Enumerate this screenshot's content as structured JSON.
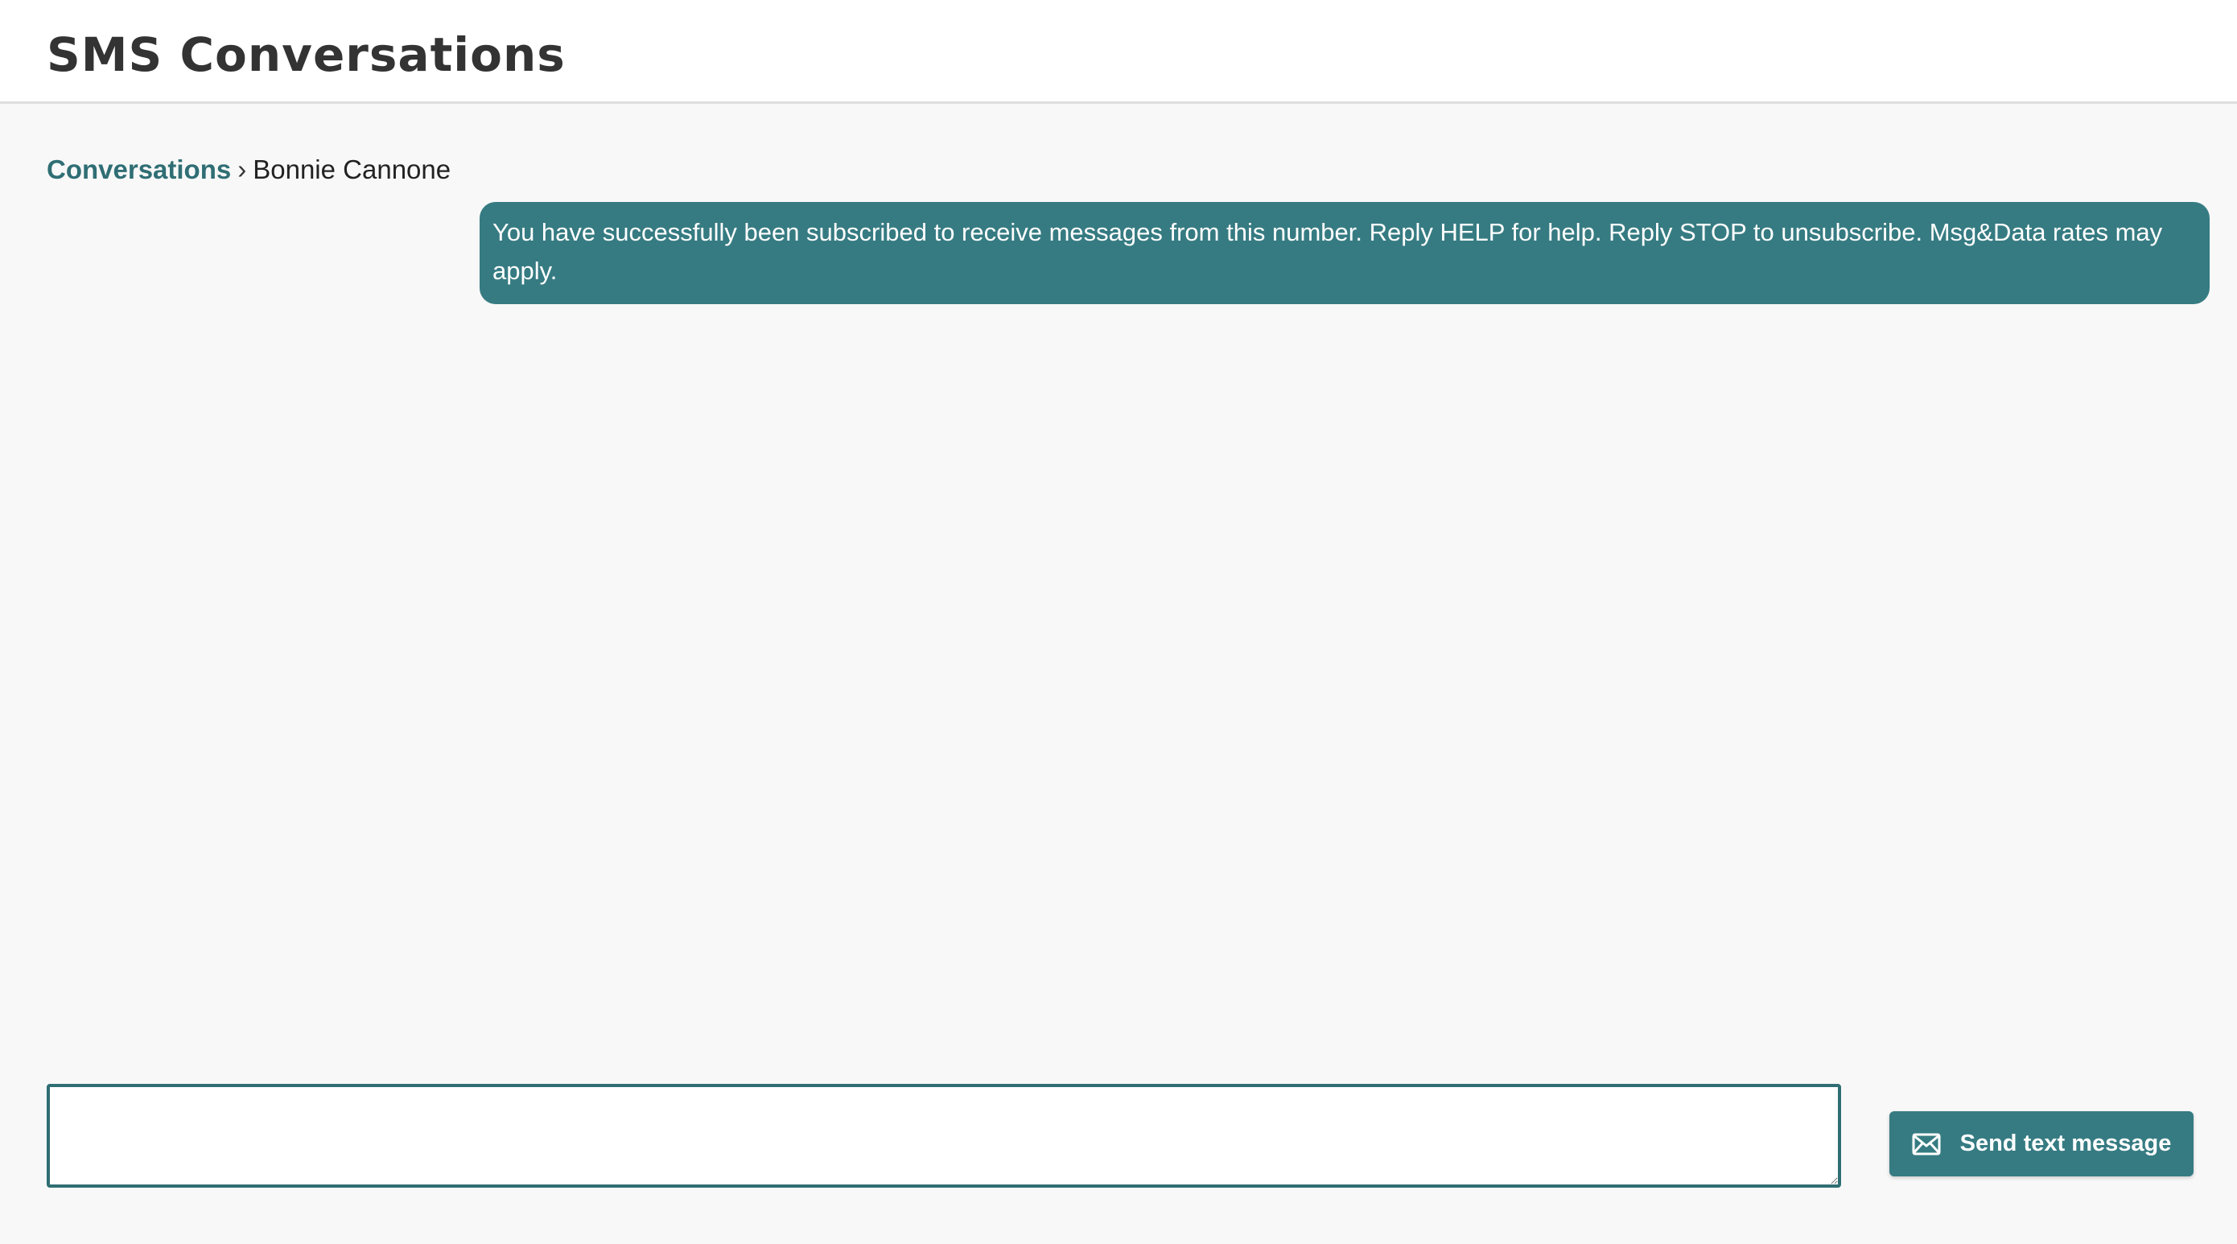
{
  "header": {
    "title": "SMS Conversations"
  },
  "breadcrumb": {
    "parent_label": "Conversations",
    "separator": "›",
    "current": "Bonnie Cannone"
  },
  "messages": [
    {
      "direction": "outgoing",
      "text": "You have successfully been subscribed to receive messages from this number. Reply HELP for help. Reply STOP to unsubscribe. Msg&Data rates may apply."
    }
  ],
  "compose": {
    "value": "",
    "placeholder": "",
    "send_label": "Send text message",
    "send_icon": "envelope-icon"
  },
  "colors": {
    "accent": "#367b82",
    "link": "#2f6e74",
    "background": "#f8f8f8",
    "header_background": "#ffffff"
  }
}
